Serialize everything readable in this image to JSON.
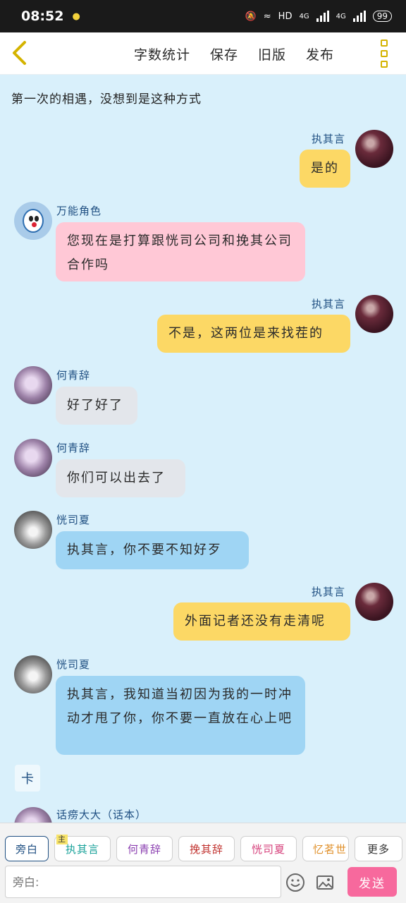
{
  "status_bar": {
    "time": "08:52",
    "network_label": "HD",
    "net_a": "4G",
    "net_b": "4G",
    "battery": "99"
  },
  "header": {
    "actions": [
      "字数统计",
      "保存",
      "旧版",
      "发布"
    ]
  },
  "chat": {
    "top_narration": "第一次的相遇，没想到是这种方式",
    "messages": [
      {
        "side": "right",
        "name": "执其言",
        "text": "是的",
        "bubble": "yellow",
        "avatar": "dark"
      },
      {
        "side": "left",
        "name": "万能角色",
        "text": "您现在是打算跟恍司公司和挽其公司合作吗",
        "bubble": "pink",
        "avatar": "blue"
      },
      {
        "side": "right",
        "name": "执其言",
        "text": "不是，这两位是来找茬的",
        "bubble": "yellow",
        "avatar": "dark"
      },
      {
        "side": "left",
        "name": "何青辞",
        "text": "好了好了",
        "bubble": "gray",
        "avatar": "purple"
      },
      {
        "side": "left",
        "name": "何青辞",
        "text": "你们可以出去了",
        "bubble": "gray",
        "avatar": "purple"
      },
      {
        "side": "left",
        "name": "恍司夏",
        "text": "执其言，你不要不知好歹",
        "bubble": "blue",
        "avatar": "gray"
      },
      {
        "side": "right",
        "name": "执其言",
        "text": "外面记者还没有走清呢",
        "bubble": "yellow",
        "avatar": "dark"
      },
      {
        "side": "left",
        "name": "恍司夏",
        "text": "执其言，我知道当初因为我的一时冲动才甩了你，你不要一直放在心上吧",
        "bubble": "blue",
        "avatar": "gray"
      }
    ],
    "narration_box": "卡",
    "partial_name": "话痨大大（话本）"
  },
  "bottom": {
    "roles": [
      {
        "label": "旁白",
        "color": "#1f4f82",
        "active": true
      },
      {
        "label": "执其言",
        "color": "#19a29a",
        "tag": "主"
      },
      {
        "label": "何青辞",
        "color": "#8b3fb0"
      },
      {
        "label": "挽其辞",
        "color": "#c0302d"
      },
      {
        "label": "恍司夏",
        "color": "#d6427c"
      },
      {
        "label": "忆茗世",
        "color": "#e0902a"
      },
      {
        "label": "更多",
        "color": "#333333"
      }
    ],
    "input_placeholder": "旁白:",
    "send_label": "发送"
  },
  "colors": {
    "background": "#d9f0fb",
    "bubble_yellow": "#fcd865",
    "bubble_pink": "#ffc8d6",
    "bubble_gray": "#e3e6eb",
    "bubble_blue": "#9fd5f4",
    "send": "#f7699d"
  }
}
